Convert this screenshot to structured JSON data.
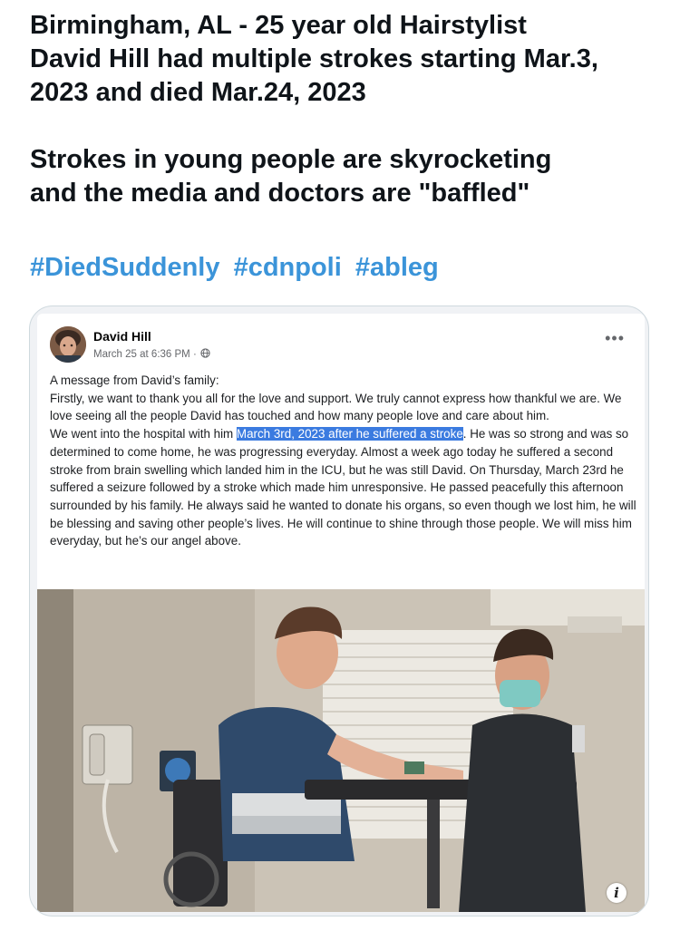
{
  "tweet": {
    "lines": [
      "Birmingham, AL - 25 year old Hairstylist",
      "David Hill had multiple strokes starting Mar.3,",
      "2023 and died Mar.24, 2023",
      "Strokes in young people are skyrocketing",
      "and the media and doctors are \"baffled\""
    ],
    "hashtags": [
      "#DiedSuddenly",
      "#cdnpoli",
      "#ableg"
    ]
  },
  "fb_post": {
    "author": "David Hill",
    "timestamp": "March 25 at 6:36 PM ·",
    "more_label": "•••",
    "body": {
      "p1": "A message from David’s family:",
      "p2": "Firstly, we want to thank you all for the love and support. We truly cannot express how thankful we are. We love seeing all the people David has touched and how many people love and care about him.",
      "p3_before": "We went into the hospital with him ",
      "p3_highlight": "March 3rd, 2023 after he suffered a stroke",
      "p3_after": ". He was so strong and was so determined to come home, he was progressing everyday. Almost a week ago today he suffered a second stroke from brain swelling which landed him in the ICU, but he was still David. On Thursday, March 23rd he suffered a seizure followed by a stroke which made him unresponsive. He passed peacefully this afternoon surrounded by his family. He always said he wanted to donate his organs, so even though we lost him, he will be blessing and saving other people’s lives. He will continue to shine through those people. We will miss him everyday, but he’s our angel above."
    },
    "info_label": "i",
    "icons": {
      "privacy": "globe-icon",
      "more": "more-options-icon",
      "info": "info-icon"
    }
  },
  "colors": {
    "hashtag": "#3b94d9",
    "highlight": "#3b7be0",
    "card_border": "#cfd9de"
  }
}
